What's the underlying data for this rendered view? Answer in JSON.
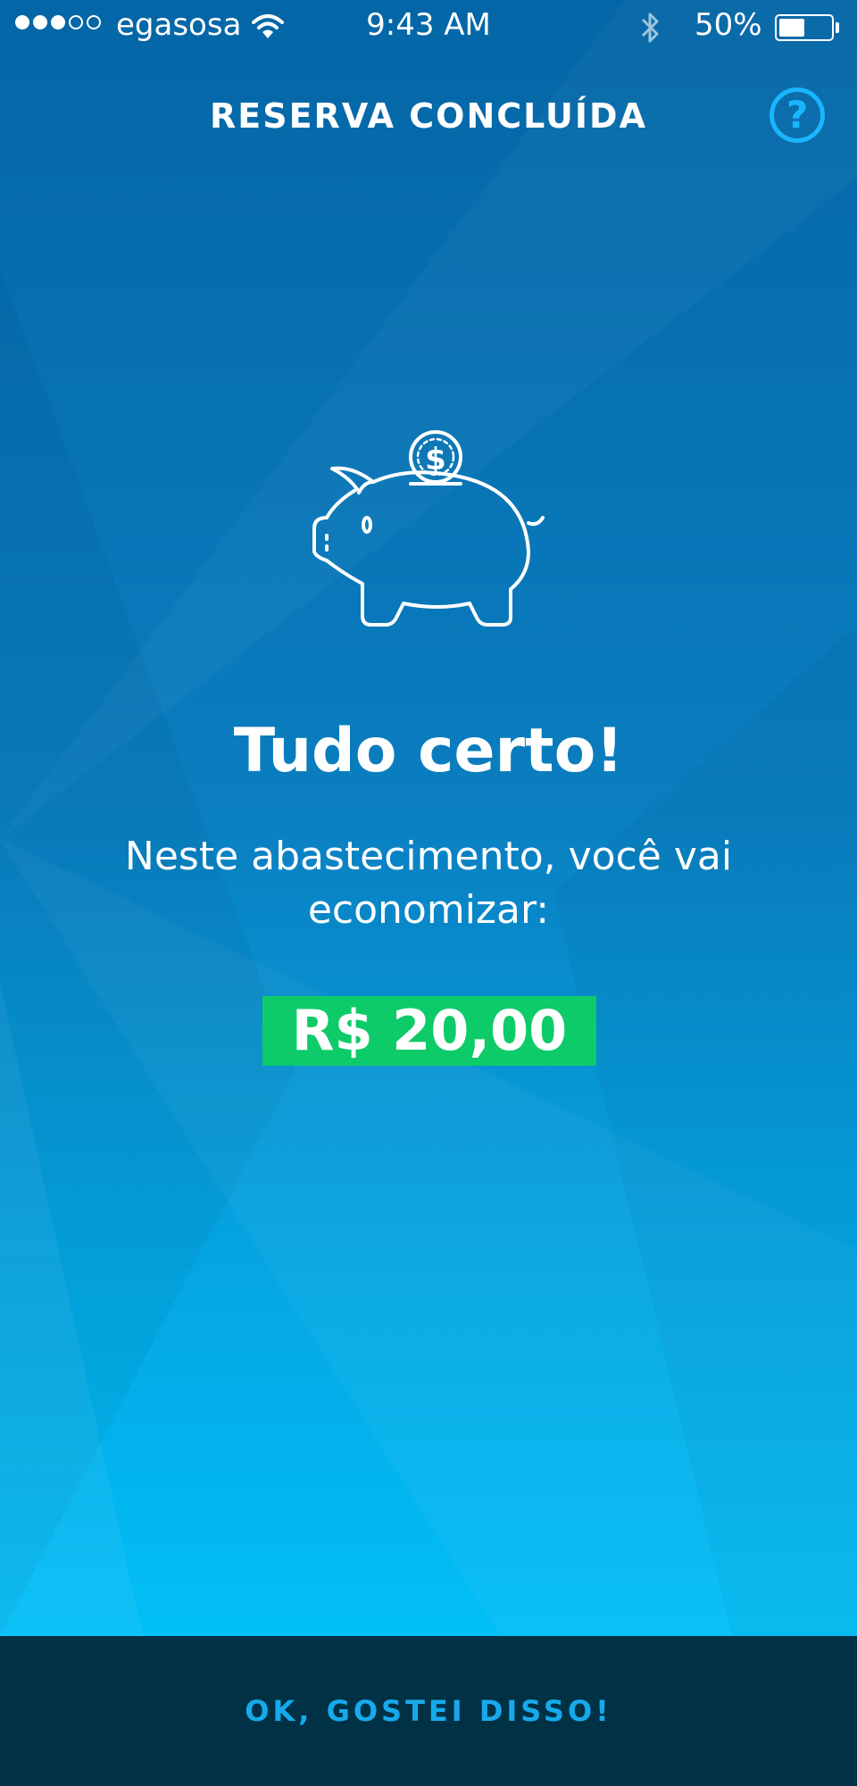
{
  "status_bar": {
    "signal_bars_filled": 3,
    "signal_bars_total": 5,
    "carrier": "egasosa",
    "time": "9:43 AM",
    "battery_percent_label": "50%",
    "battery_level": 0.5,
    "icons": [
      "wifi-icon",
      "bluetooth-icon",
      "battery-icon"
    ]
  },
  "header": {
    "title": "RESERVA CONCLUÍDA",
    "help_label": "?"
  },
  "main": {
    "illustration": "piggy-bank-coin-icon",
    "coin_symbol": "$",
    "headline": "Tudo certo!",
    "message": "Neste abastecimento, você vai economizar:",
    "amount": "R$ 20,00"
  },
  "footer": {
    "button_label": "OK, GOSTEI DISSO!"
  },
  "colors": {
    "background_top": "#0466a6",
    "background_bottom": "#00c9ff",
    "accent": "#19b6ff",
    "amount_highlight": "#0ecb69",
    "footer_background": "#003144",
    "footer_text": "#17a9ec"
  }
}
